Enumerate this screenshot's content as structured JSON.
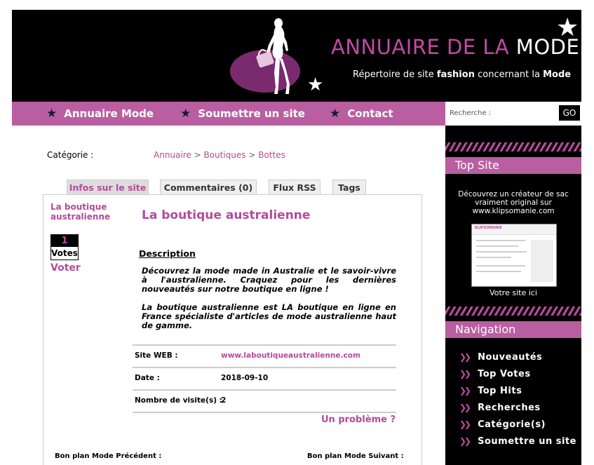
{
  "header": {
    "title_main": "ANNUAIRE DE LA ",
    "title_accent": "MODE",
    "subtitle_pre": "Répertoire de site ",
    "subtitle_bold1": "fashion",
    "subtitle_mid": " concernant la ",
    "subtitle_bold2": "Mode"
  },
  "nav": {
    "items": [
      {
        "label": "Annuaire Mode"
      },
      {
        "label": "Soumettre un site"
      },
      {
        "label": "Contact"
      }
    ]
  },
  "search": {
    "placeholder": "Recherche :",
    "button": "GO"
  },
  "content": {
    "category_label": "Catégorie :",
    "breadcrumb": [
      "Annuaire",
      "Boutiques",
      "Bottes"
    ],
    "breadcrumb_sep": " > ",
    "tabs": [
      {
        "label": "Infos sur le site",
        "active": true
      },
      {
        "label": "Commentaires (0)"
      },
      {
        "label": "Flux RSS"
      },
      {
        "label": "Tags"
      }
    ],
    "panel_title": "La boutique australienne",
    "votes_count": "1",
    "votes_label": "Votes",
    "voter_label": "Voter",
    "site_name": "La boutique australienne",
    "description_label": "Description",
    "description": [
      "Découvrez la mode made in Australie et le savoir-vivre à l'australienne. Craquez pour les dernières nouveautés sur notre boutique en ligne !",
      "La boutique australienne est LA boutique en ligne en France spécialiste d'articles de mode australienne haut de gamme."
    ],
    "info": [
      {
        "key": "Site WEB :",
        "value": "www.laboutiqueaustralienne.com"
      },
      {
        "key": "Date :",
        "value": "2018-09-10"
      },
      {
        "key": "Nombre de visite(s) :",
        "value": "2"
      }
    ],
    "problem_link": "Un problème ?",
    "prev_label": "Bon plan Mode Précédent :",
    "next_label": "Bon plan Mode Suivant :"
  },
  "sidebar": {
    "top_site_title": "Top Site",
    "promo_text": "Découvrez un créateur de sac vraiment original sur www.klipsomanie.com",
    "thumb_logo": "KLIPSOMANIE",
    "thumb_caption": "Votre site ici",
    "navigation_title": "Navigation",
    "nav_items": [
      "Nouveautés",
      "Top Votes",
      "Top Hits",
      "Recherches",
      "Catégorie(s)",
      "Soumettre un site"
    ]
  },
  "colors": {
    "accent": "#b95ea0",
    "link": "#b54a9a",
    "header_bg": "#000000"
  }
}
